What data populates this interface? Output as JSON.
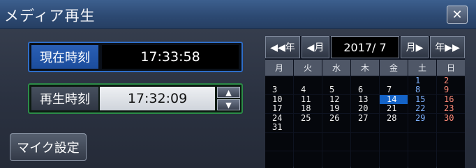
{
  "window": {
    "title": "メディア再生",
    "close_label": "✕"
  },
  "current_time": {
    "label": "現在時刻",
    "value": "17:33:58"
  },
  "playback_time": {
    "label": "再生時刻",
    "value": "17:32:09",
    "up_icon": "▲",
    "down_icon": "▼"
  },
  "mic_button": {
    "label": "マイク設定"
  },
  "calendar": {
    "nav": {
      "prev_year": "◀◀年",
      "prev_month": "◀月",
      "month": "2017/ 7",
      "next_month": "月▶",
      "next_year": "年▶▶"
    },
    "weekdays": [
      "月",
      "火",
      "水",
      "木",
      "金",
      "土",
      "日"
    ],
    "weeks": [
      {
        "top": [
          "",
          "",
          "",
          "",
          "",
          "1",
          "2"
        ],
        "bottom": [
          "3",
          "4",
          "5",
          "6",
          "7",
          "8",
          "9"
        ]
      },
      {
        "top": [
          "10",
          "11",
          "12",
          "13",
          "14",
          "15",
          "16"
        ],
        "bottom": [
          "17",
          "18",
          "19",
          "20",
          "21",
          "22",
          "23"
        ]
      },
      {
        "top": [
          "24",
          "25",
          "26",
          "27",
          "28",
          "29",
          "30"
        ],
        "bottom": [
          "31",
          "",
          "",
          "",
          "",
          "",
          ""
        ]
      }
    ],
    "selected_day": "14",
    "colors": {
      "saturday": "#7fb2ff",
      "sunday": "#ff8a78",
      "selected": "#1463c7"
    }
  }
}
